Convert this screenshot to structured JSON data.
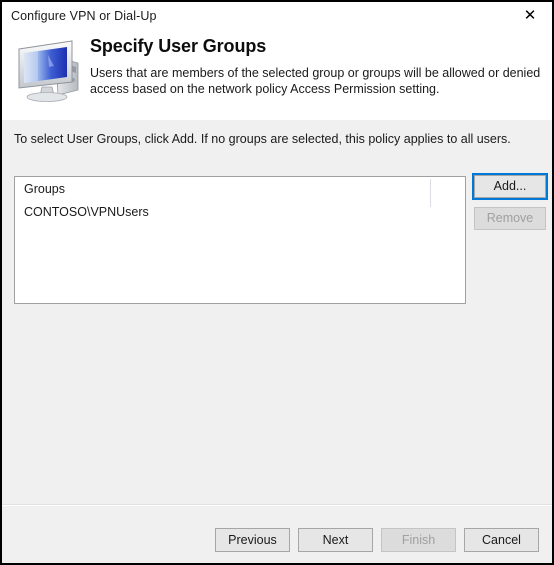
{
  "window": {
    "title": "Configure VPN or Dial-Up",
    "close_icon": "close-icon",
    "close_glyph": "✕"
  },
  "header": {
    "icon": "computer-monitor-icon",
    "title": "Specify User Groups",
    "description": "Users that are members of the selected group or groups will be allowed or denied access based on the network policy Access Permission setting."
  },
  "main": {
    "instruction": "To select User Groups, click Add. If no groups are selected, this policy applies to all users.",
    "list": {
      "columns": [
        "Groups"
      ],
      "rows": [
        {
          "group": "CONTOSO\\VPNUsers"
        }
      ]
    },
    "side_buttons": [
      {
        "label": "Add...",
        "state": "focused"
      },
      {
        "label": "Remove",
        "state": "disabled"
      }
    ]
  },
  "footer": {
    "buttons": [
      {
        "label": "Previous",
        "state": "enabled"
      },
      {
        "label": "Next",
        "state": "enabled"
      },
      {
        "label": "Finish",
        "state": "disabled"
      },
      {
        "label": "Cancel",
        "state": "enabled"
      }
    ]
  },
  "colors": {
    "focus_blue": "#0078d7",
    "window_bg": "#f0f0f0",
    "header_bg": "#ffffff",
    "text": "#1a1a1a",
    "disabled_text": "#a0a0a0"
  }
}
